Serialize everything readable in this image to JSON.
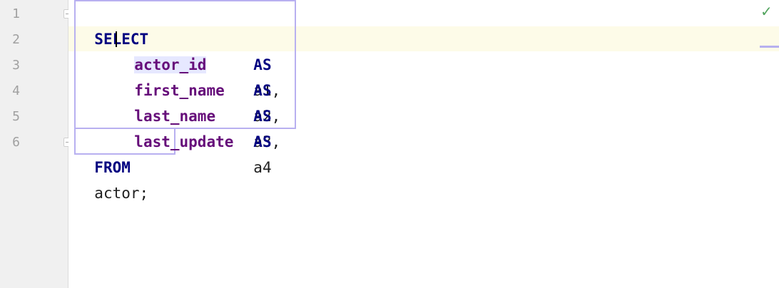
{
  "editor": {
    "line_numbers": [
      "1",
      "2",
      "3",
      "4",
      "5",
      "6"
    ],
    "lines": [
      {
        "keyword": "SELECT"
      },
      {
        "column": "actor_id",
        "alias_keyword": "AS",
        "alias": "a1,"
      },
      {
        "column": "first_name",
        "alias_keyword": "AS",
        "alias": "a2,"
      },
      {
        "column": "last_name",
        "alias_keyword": "AS",
        "alias": "a3,"
      },
      {
        "column": "last_update",
        "alias_keyword": "AS",
        "alias": "a4"
      },
      {
        "keyword": "FROM",
        "table": "actor",
        "terminator": ";"
      }
    ]
  },
  "status": {
    "check_icon": "check-icon",
    "check_color": "#50a35c"
  },
  "colors": {
    "keyword": "#000080",
    "column": "#660e7a",
    "current_line": "#fdfbe8",
    "selection_border": "#b8b0f0"
  }
}
